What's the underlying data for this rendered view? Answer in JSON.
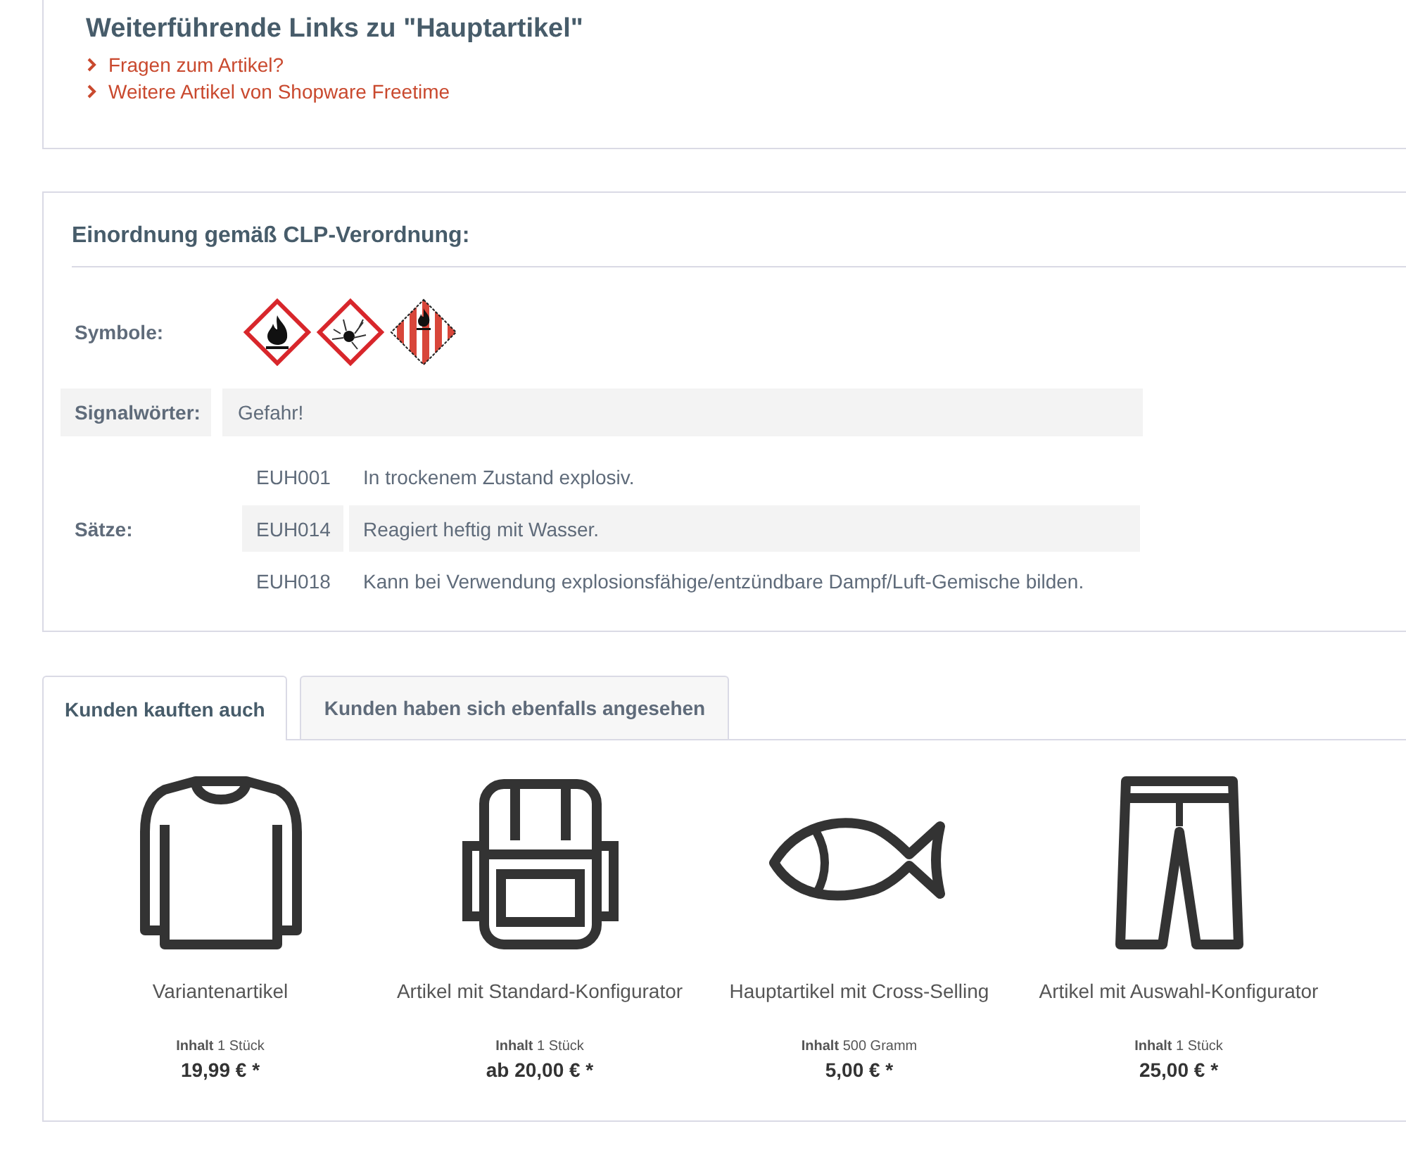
{
  "links_panel": {
    "title": "Weiterführende Links zu \"Hauptartikel\"",
    "links": [
      "Fragen zum Artikel?",
      "Weitere Artikel von Shopware Freetime"
    ]
  },
  "clp": {
    "title": "Einordnung gemäß CLP-Verordnung:",
    "symbols_label": "Symbole:",
    "signal_label": "Signalwörter:",
    "signal_value": "Gefahr!",
    "sentences_label": "Sätze:",
    "sentences": [
      {
        "code": "EUH001",
        "text": "In trockenem Zustand explosiv."
      },
      {
        "code": "EUH014",
        "text": "Reagiert heftig mit Wasser."
      },
      {
        "code": "EUH018",
        "text": "Kann bei Verwendung explosionsfähige/entzündbare Dampf/Luft-Gemische bilden."
      }
    ]
  },
  "tabs": [
    {
      "label": "Kunden kauften auch",
      "selected": true
    },
    {
      "label": "Kunden haben sich ebenfalls angesehen",
      "selected": false
    }
  ],
  "products": [
    {
      "name": "Variantenartikel",
      "content_label": "Inhalt",
      "content": "1 Stück",
      "price": "19,99 € *"
    },
    {
      "name": "Artikel mit Standard-Konfigurator",
      "content_label": "Inhalt",
      "content": "1 Stück",
      "price": "ab 20,00 € *"
    },
    {
      "name": "Hauptartikel mit Cross-Selling",
      "content_label": "Inhalt",
      "content": "500 Gramm",
      "price": "5,00 € *"
    },
    {
      "name": "Artikel mit Auswahl-Konfigurator",
      "content_label": "Inhalt",
      "content": "1 Stück",
      "price": "25,00 € *"
    }
  ]
}
